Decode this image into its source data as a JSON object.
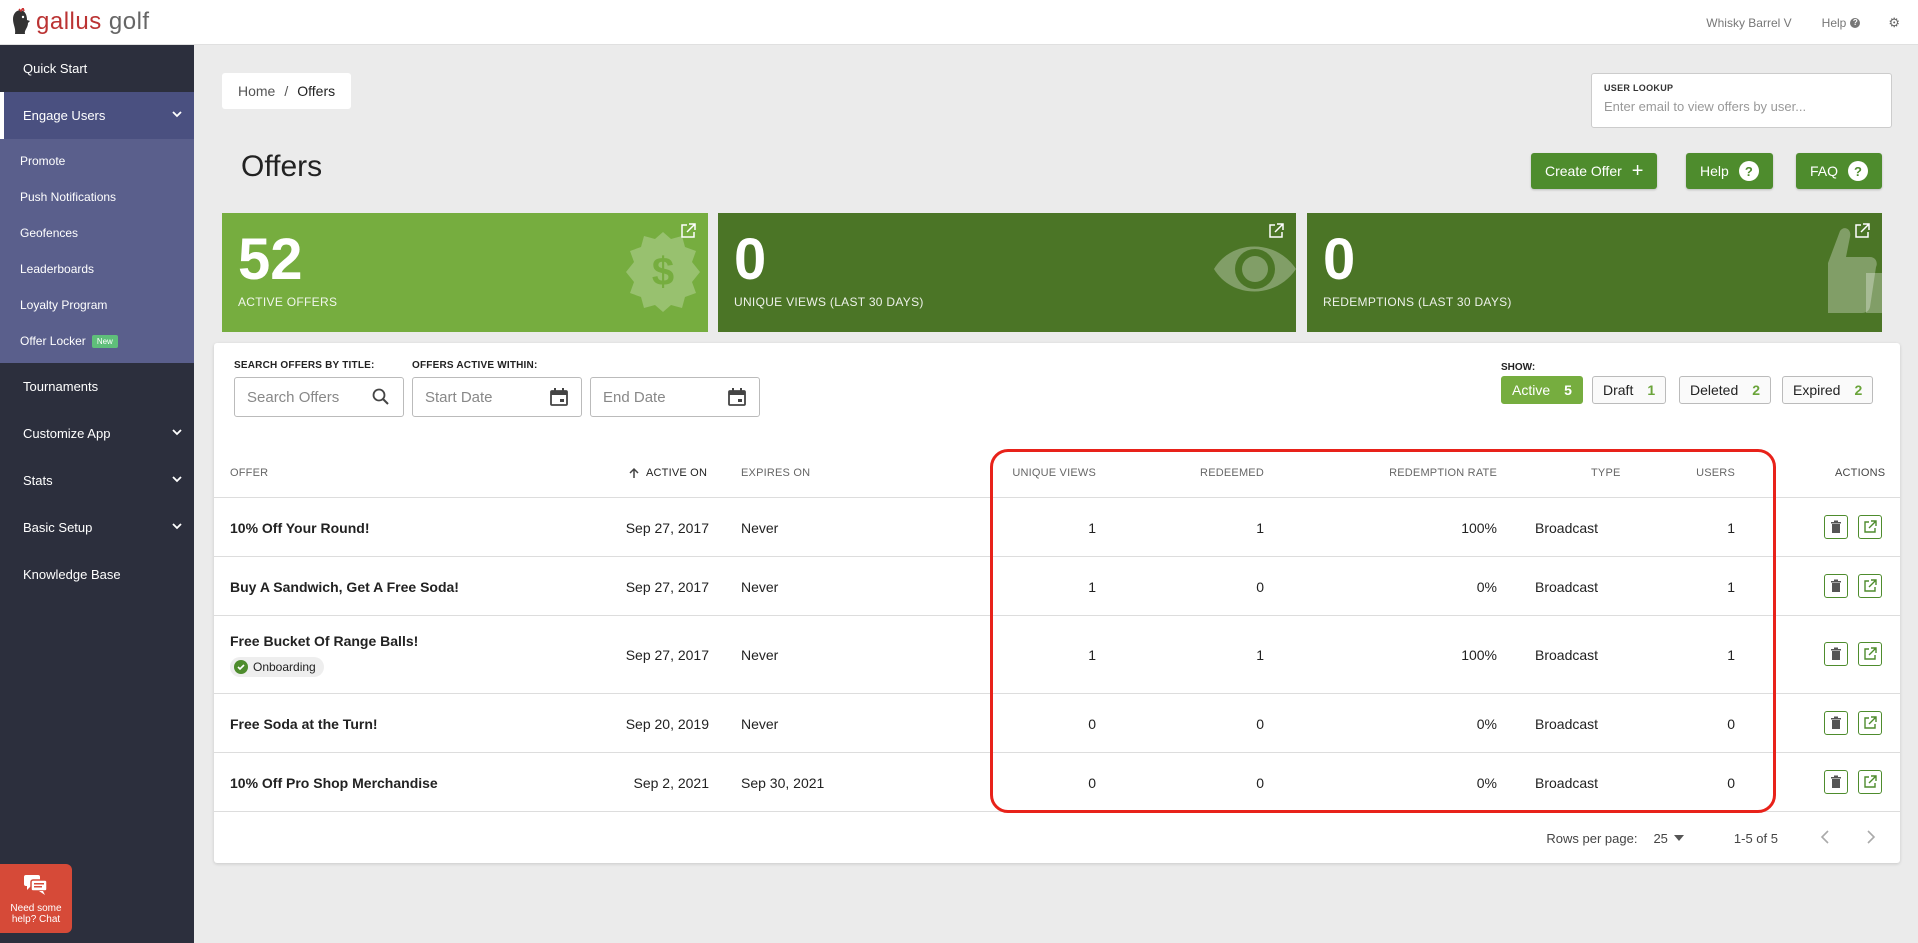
{
  "topbar": {
    "logo_text_a": "gallus",
    "logo_text_b": "golf",
    "user_name": "Whisky Barrel V",
    "help_label": "Help"
  },
  "sidebar": {
    "items": [
      {
        "label": "Quick Start"
      },
      {
        "label": "Engage Users"
      },
      {
        "label": "Tournaments"
      },
      {
        "label": "Customize App"
      },
      {
        "label": "Stats"
      },
      {
        "label": "Basic Setup"
      },
      {
        "label": "Knowledge Base"
      }
    ],
    "subitems": [
      {
        "label": "Promote"
      },
      {
        "label": "Push Notifications"
      },
      {
        "label": "Geofences"
      },
      {
        "label": "Leaderboards"
      },
      {
        "label": "Loyalty Program"
      },
      {
        "label": "Offer Locker"
      }
    ],
    "new_badge": "New"
  },
  "chat": {
    "label": "Need some help? Chat"
  },
  "breadcrumb": {
    "home": "Home",
    "sep": "/",
    "current": "Offers"
  },
  "lookup": {
    "label": "USER LOOKUP",
    "placeholder": "Enter email to view offers by user..."
  },
  "page": {
    "title": "Offers"
  },
  "buttons": {
    "create": "Create Offer",
    "help": "Help",
    "faq": "FAQ"
  },
  "cards": [
    {
      "value": "52",
      "label": "ACTIVE OFFERS",
      "color": "#76ad3f"
    },
    {
      "value": "0",
      "label": "UNIQUE VIEWS (LAST 30 DAYS)",
      "color": "#4b7526"
    },
    {
      "value": "0",
      "label": "REDEMPTIONS (LAST 30 DAYS)",
      "color": "#4b7526"
    }
  ],
  "filters": {
    "search_label": "SEARCH OFFERS BY TITLE:",
    "search_placeholder": "Search Offers",
    "active_label": "OFFERS ACTIVE WITHIN:",
    "start_placeholder": "Start Date",
    "end_placeholder": "End Date",
    "show_label": "SHOW:",
    "chips": [
      {
        "label": "Active",
        "count": "5"
      },
      {
        "label": "Draft",
        "count": "1"
      },
      {
        "label": "Deleted",
        "count": "2"
      },
      {
        "label": "Expired",
        "count": "2"
      }
    ]
  },
  "table": {
    "headers": {
      "offer": "OFFER",
      "active_on": "ACTIVE ON",
      "expires_on": "EXPIRES ON",
      "unique_views": "UNIQUE VIEWS",
      "redeemed": "REDEEMED",
      "redemption_rate": "REDEMPTION RATE",
      "type": "TYPE",
      "users": "USERS",
      "actions": "ACTIONS"
    },
    "rows": [
      {
        "offer": "10% Off Your Round!",
        "tag": "",
        "active_on": "Sep 27, 2017",
        "expires_on": "Never",
        "unique_views": "1",
        "redeemed": "1",
        "rate": "100%",
        "type": "Broadcast",
        "users": "1"
      },
      {
        "offer": "Buy A Sandwich, Get A Free Soda!",
        "tag": "",
        "active_on": "Sep 27, 2017",
        "expires_on": "Never",
        "unique_views": "1",
        "redeemed": "0",
        "rate": "0%",
        "type": "Broadcast",
        "users": "1"
      },
      {
        "offer": "Free Bucket Of Range Balls!",
        "tag": "Onboarding",
        "active_on": "Sep 27, 2017",
        "expires_on": "Never",
        "unique_views": "1",
        "redeemed": "1",
        "rate": "100%",
        "type": "Broadcast",
        "users": "1"
      },
      {
        "offer": "Free Soda at the Turn!",
        "tag": "",
        "active_on": "Sep 20, 2019",
        "expires_on": "Never",
        "unique_views": "0",
        "redeemed": "0",
        "rate": "0%",
        "type": "Broadcast",
        "users": "0"
      },
      {
        "offer": "10% Off Pro Shop Merchandise",
        "tag": "",
        "active_on": "Sep 2, 2021",
        "expires_on": "Sep 30, 2021",
        "unique_views": "0",
        "redeemed": "0",
        "rate": "0%",
        "type": "Broadcast",
        "users": "0"
      }
    ]
  },
  "pagination": {
    "rows_label": "Rows per page:",
    "rows_value": "25",
    "range": "1-5 of 5"
  },
  "colors": {
    "accent": "#4e8c2d",
    "highlight": "#e8221a"
  }
}
